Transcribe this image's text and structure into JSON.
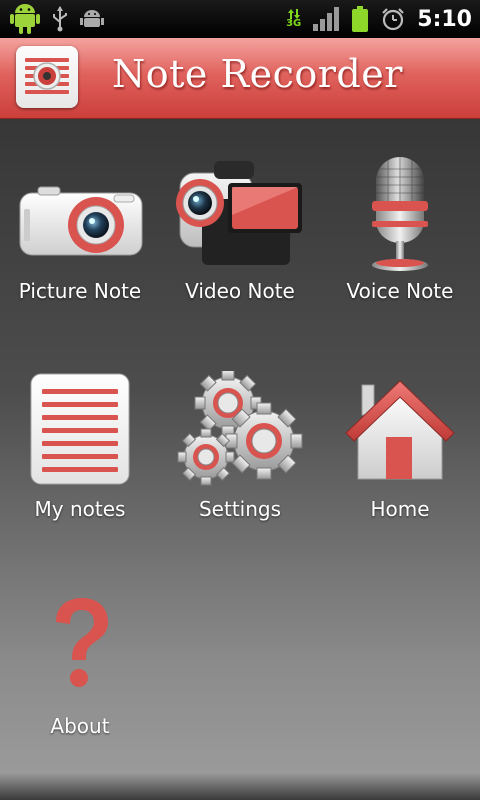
{
  "status_bar": {
    "network": "3G",
    "time": "5:10"
  },
  "header": {
    "title": "Note Recorder"
  },
  "menu": {
    "picture_note": "Picture Note",
    "video_note": "Video Note",
    "voice_note": "Voice Note",
    "my_notes": "My notes",
    "settings": "Settings",
    "home": "Home",
    "about": "About"
  },
  "icons": {
    "picture_note": "camera-icon",
    "video_note": "video-camera-icon",
    "voice_note": "microphone-icon",
    "my_notes": "notes-list-icon",
    "settings": "gears-icon",
    "home": "house-icon",
    "about": "question-mark-icon"
  },
  "colors": {
    "accent": "#d9534f",
    "accent_dark": "#b8322e",
    "header_light": "#f4a39f"
  }
}
